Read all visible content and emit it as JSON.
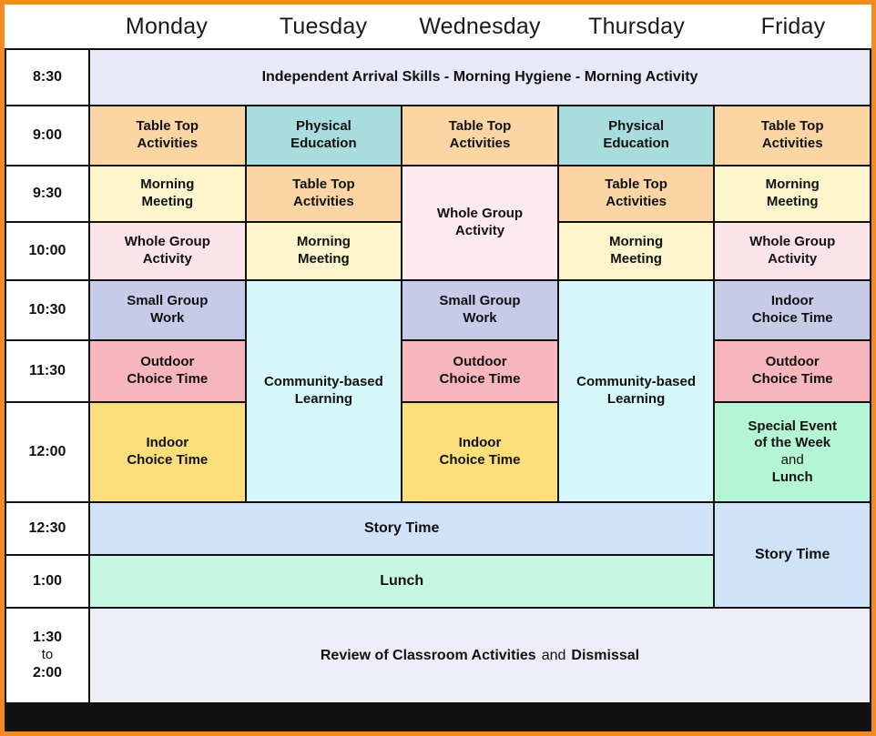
{
  "header": {
    "days": [
      "Monday",
      "Tuesday",
      "Wednesday",
      "Thursday",
      "Friday"
    ]
  },
  "times": [
    {
      "label": "8:30"
    },
    {
      "label": "9:00"
    },
    {
      "label": "9:30"
    },
    {
      "label": "10:00"
    },
    {
      "label": "10:30"
    },
    {
      "label": "11:30"
    },
    {
      "label": "12:00"
    },
    {
      "label": "12:30"
    },
    {
      "label": "1:00"
    },
    {
      "label": "1:30",
      "mid": "to",
      "end": "2:00"
    }
  ],
  "colors": {
    "border_outer": "#f28c1e",
    "border_grid": "#111111",
    "lavender_blue": "#e8e9f7",
    "peach_orange": "#fbd6a4",
    "cream_yellow": "#fdf6cd",
    "pale_pink": "#fbe3ea",
    "light_pink": "#fdeaf1",
    "teal": "#a9dcdc",
    "periwinkle": "#c8cbe8",
    "rose": "#f6b6bc",
    "golden_yellow": "#fcdf7a",
    "pale_cyan": "#d6f7f9",
    "mint_green": "#b4f5d6",
    "sky_blue": "#cfe2f8",
    "aqua_mint": "#c6f7e2"
  },
  "cells": {
    "arrival": {
      "text": "Independent Arrival Skills - Morning Hygiene - Morning Activity",
      "color": "#e8e9f7"
    },
    "table_top": {
      "line1": "Table Top",
      "line2": "Activities",
      "color": "#fbd6a4"
    },
    "physical_ed": {
      "line1": "Physical",
      "line2": "Education",
      "color": "#a9dcdc"
    },
    "morning_meeting": {
      "line1": "Morning",
      "line2": "Meeting",
      "color": "#fdf6cd"
    },
    "whole_group": {
      "line1": "Whole Group",
      "line2": "Activity",
      "color": "#fbe3ea"
    },
    "whole_group_wed": {
      "line1": "Whole Group",
      "line2": "Activity",
      "color": "#fdeaf1"
    },
    "small_group": {
      "line1": "Small Group",
      "line2": "Work",
      "color": "#c8cbe8"
    },
    "indoor_choice_lav": {
      "line1": "Indoor",
      "line2": "Choice Time",
      "color": "#c8cbe8"
    },
    "outdoor_choice": {
      "line1": "Outdoor",
      "line2": "Choice Time",
      "color": "#f6b6bc"
    },
    "indoor_choice": {
      "line1": "Indoor",
      "line2": "Choice Time",
      "color": "#fcdf7a"
    },
    "community": {
      "line1": "Community-based",
      "line2": "Learning",
      "color": "#d6f7f9"
    },
    "special_event": {
      "line1": "Special Event",
      "line2": "of the Week",
      "line3": "and",
      "line4": "Lunch",
      "color": "#b4f5d6"
    },
    "story_time": {
      "text": "Story Time",
      "color": "#cfe2f8"
    },
    "story_time_friday": {
      "text": "Story Time",
      "color": "#cfe2f8"
    },
    "lunch": {
      "text": "Lunch",
      "color": "#c6f7e2"
    },
    "review": {
      "part1": "Review of Classroom Activities",
      "part2": "and",
      "part3": "Dismissal",
      "color": "#eeeef8"
    }
  }
}
